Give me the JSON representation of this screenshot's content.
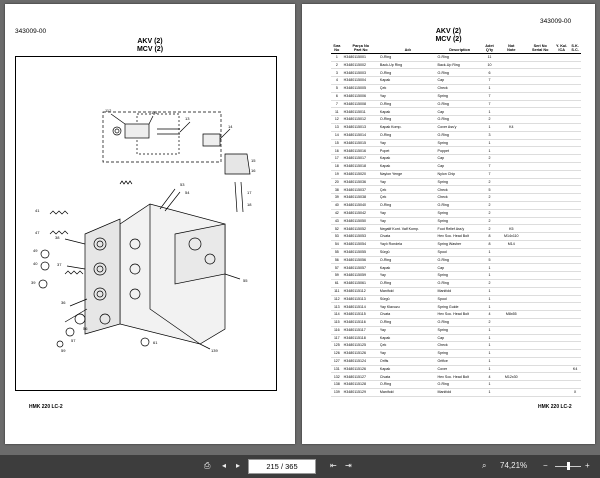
{
  "left_page": {
    "doc_number": "343009-00",
    "title_1": "AKV (2)",
    "title_2": "MCV (2)",
    "footer": "HMK 220 LC-2"
  },
  "right_page": {
    "doc_number": "343009-00",
    "title_1": "AKV (2)",
    "title_2": "MCV (2)",
    "footer": "HMK 220 LC-2",
    "headers": {
      "no": "Sıra\nNo",
      "part_no": "Parça No\nPart No",
      "name": "Adı",
      "description": "Description",
      "qty": "Adet\nQ'ty",
      "note": "Not\nNote",
      "serial_no": "Seri No\nSerial No",
      "cat": "Y. Kul.\nICA",
      "sc": "S.K.\nS.C."
    },
    "rows": [
      {
        "no": "1",
        "part_no": "H3480115001",
        "name": "O-Ring",
        "desc": "O-Ring",
        "qty": "11",
        "note": "",
        "cat": "",
        "sc": ""
      },
      {
        "no": "2",
        "part_no": "H3480115002",
        "name": "Back-Up Ring",
        "desc": "Back-Up Ring",
        "qty": "10",
        "note": "",
        "cat": "",
        "sc": ""
      },
      {
        "no": "3",
        "part_no": "H3480115003",
        "name": "O-Ring",
        "desc": "O-Ring",
        "qty": "6",
        "note": "",
        "cat": "",
        "sc": ""
      },
      {
        "no": "4",
        "part_no": "H3480115004",
        "name": "Kapak",
        "desc": "Cap",
        "qty": "7",
        "note": "",
        "cat": "",
        "sc": ""
      },
      {
        "no": "5",
        "part_no": "H3480115005",
        "name": "Çek",
        "desc": "Check",
        "qty": "1",
        "note": "",
        "cat": "",
        "sc": ""
      },
      {
        "no": "6",
        "part_no": "H3480115006",
        "name": "Yay",
        "desc": "Spring",
        "qty": "7",
        "note": "",
        "cat": "",
        "sc": ""
      },
      {
        "no": "7",
        "part_no": "H3480115008",
        "name": "O-Ring",
        "desc": "O-Ring",
        "qty": "7",
        "note": "",
        "cat": "",
        "sc": ""
      },
      {
        "no": "11",
        "part_no": "H3480115011",
        "name": "Kapak",
        "desc": "Cap",
        "qty": "1",
        "note": "",
        "cat": "",
        "sc": ""
      },
      {
        "no": "12",
        "part_no": "H3480115012",
        "name": "O-Ring",
        "desc": "O-Ring",
        "qty": "2",
        "note": "",
        "cat": "",
        "sc": ""
      },
      {
        "no": "13",
        "part_no": "H3480115013",
        "name": "Kapak Komp.",
        "desc": "Cover Ass'y",
        "qty": "1",
        "note": "K4",
        "cat": "",
        "sc": ""
      },
      {
        "no": "14",
        "part_no": "H3480115014",
        "name": "O-Ring",
        "desc": "O-Ring",
        "qty": "3",
        "note": "",
        "cat": "",
        "sc": ""
      },
      {
        "no": "15",
        "part_no": "H3480115015",
        "name": "Yay",
        "desc": "Spring",
        "qty": "1",
        "note": "",
        "cat": "",
        "sc": ""
      },
      {
        "no": "16",
        "part_no": "H3480115016",
        "name": "Popet",
        "desc": "Poppet",
        "qty": "1",
        "note": "",
        "cat": "",
        "sc": ""
      },
      {
        "no": "17",
        "part_no": "H3480115017",
        "name": "Kapak",
        "desc": "Cap",
        "qty": "2",
        "note": "",
        "cat": "",
        "sc": ""
      },
      {
        "no": "18",
        "part_no": "H3480115018",
        "name": "Kapak",
        "desc": "Cap",
        "qty": "7",
        "note": "",
        "cat": "",
        "sc": ""
      },
      {
        "no": "19",
        "part_no": "H3480115020",
        "name": "Naylon Yenge",
        "desc": "Nylon Chip",
        "qty": "7",
        "note": "",
        "cat": "",
        "sc": ""
      },
      {
        "no": "20",
        "part_no": "H3480115036",
        "name": "Yay",
        "desc": "Spring",
        "qty": "2",
        "note": "",
        "cat": "",
        "sc": ""
      },
      {
        "no": "38",
        "part_no": "H3480115037",
        "name": "Çek",
        "desc": "Check",
        "qty": "5",
        "note": "",
        "cat": "",
        "sc": ""
      },
      {
        "no": "39",
        "part_no": "H3480115038",
        "name": "Çek",
        "desc": "Check",
        "qty": "2",
        "note": "",
        "cat": "",
        "sc": ""
      },
      {
        "no": "40",
        "part_no": "H3480115040",
        "name": "O-Ring",
        "desc": "O-Ring",
        "qty": "2",
        "note": "",
        "cat": "",
        "sc": ""
      },
      {
        "no": "42",
        "part_no": "H3480115042",
        "name": "Yay",
        "desc": "Spring",
        "qty": "2",
        "note": "",
        "cat": "",
        "sc": ""
      },
      {
        "no": "43",
        "part_no": "H3480115050",
        "name": "Yay",
        "desc": "Spring",
        "qty": "2",
        "note": "",
        "cat": "",
        "sc": ""
      },
      {
        "no": "52",
        "part_no": "H3480115052",
        "name": "Negatif Kont. Valf Komp.",
        "desc": "Foot Relief Ass'y",
        "qty": "2",
        "note": "K5",
        "cat": "",
        "sc": ""
      },
      {
        "no": "53",
        "part_no": "H3480115053",
        "name": "Civata",
        "desc": "Hex Soc. Head Bolt",
        "qty": "8",
        "note": "M14x110",
        "cat": "",
        "sc": ""
      },
      {
        "no": "54",
        "part_no": "H3480115054",
        "name": "Yaylı Rondela",
        "desc": "Spring Washer",
        "qty": "8",
        "note": "M14",
        "cat": "",
        "sc": ""
      },
      {
        "no": "55",
        "part_no": "H3480115055",
        "name": "Sürgü",
        "desc": "Spool",
        "qty": "1",
        "note": "",
        "cat": "",
        "sc": ""
      },
      {
        "no": "56",
        "part_no": "H3480115056",
        "name": "O-Ring",
        "desc": "O-Ring",
        "qty": "5",
        "note": "",
        "cat": "",
        "sc": ""
      },
      {
        "no": "57",
        "part_no": "H3480115057",
        "name": "Kapak",
        "desc": "Cap",
        "qty": "1",
        "note": "",
        "cat": "",
        "sc": ""
      },
      {
        "no": "59",
        "part_no": "H3480115059",
        "name": "Yay",
        "desc": "Spring",
        "qty": "1",
        "note": "",
        "cat": "",
        "sc": ""
      },
      {
        "no": "61",
        "part_no": "H3480115061",
        "name": "O-Ring",
        "desc": "O-Ring",
        "qty": "2",
        "note": "",
        "cat": "",
        "sc": ""
      },
      {
        "no": "111",
        "part_no": "H3480115112",
        "name": "Manifold",
        "desc": "Manifold",
        "qty": "1",
        "note": "",
        "cat": "",
        "sc": ""
      },
      {
        "no": "112",
        "part_no": "H3480115113",
        "name": "Sürgü",
        "desc": "Spool",
        "qty": "1",
        "note": "",
        "cat": "",
        "sc": ""
      },
      {
        "no": "113",
        "part_no": "H3480115114",
        "name": "Yay Klavuzu",
        "desc": "Spring Guide",
        "qty": "1",
        "note": "",
        "cat": "",
        "sc": ""
      },
      {
        "no": "114",
        "part_no": "H3480115115",
        "name": "Civata",
        "desc": "Hex Soc. Head Bolt",
        "qty": "4",
        "note": "M8x55",
        "cat": "",
        "sc": ""
      },
      {
        "no": "115",
        "part_no": "H3480115116",
        "name": "O-Ring",
        "desc": "O-Ring",
        "qty": "2",
        "note": "",
        "cat": "",
        "sc": ""
      },
      {
        "no": "116",
        "part_no": "H3480115117",
        "name": "Yay",
        "desc": "Spring",
        "qty": "1",
        "note": "",
        "cat": "",
        "sc": ""
      },
      {
        "no": "117",
        "part_no": "H3480115118",
        "name": "Kapak",
        "desc": "Cap",
        "qty": "1",
        "note": "",
        "cat": "",
        "sc": ""
      },
      {
        "no": "125",
        "part_no": "H3480115125",
        "name": "Çek",
        "desc": "Check",
        "qty": "1",
        "note": "",
        "cat": "",
        "sc": ""
      },
      {
        "no": "126",
        "part_no": "H3480115126",
        "name": "Yay",
        "desc": "Spring",
        "qty": "1",
        "note": "",
        "cat": "",
        "sc": ""
      },
      {
        "no": "127",
        "part_no": "H3480115124",
        "name": "Orifis",
        "desc": "Orifice",
        "qty": "1",
        "note": "",
        "cat": "",
        "sc": ""
      },
      {
        "no": "131",
        "part_no": "H3480115126",
        "name": "Kapak",
        "desc": "Cover",
        "qty": "1",
        "note": "",
        "cat": "",
        "sc": "K4"
      },
      {
        "no": "132",
        "part_no": "H3480115127",
        "name": "Civata",
        "desc": "Hex Soc. Head Bolt",
        "qty": "4",
        "note": "M12x30",
        "cat": "",
        "sc": ""
      },
      {
        "no": "138",
        "part_no": "H3480115128",
        "name": "O-Ring",
        "desc": "O-Ring",
        "qty": "1",
        "note": "",
        "cat": "",
        "sc": ""
      },
      {
        "no": "139",
        "part_no": "H3480115129",
        "name": "Manifold",
        "desc": "Manifold",
        "qty": "1",
        "note": "",
        "cat": "",
        "sc": "X"
      }
    ]
  },
  "diagram_callouts": [
    "112",
    "131",
    "13",
    "14",
    "15",
    "16",
    "17",
    "18",
    "41",
    "47",
    "49",
    "40",
    "39",
    "38",
    "37",
    "36",
    "56",
    "57",
    "59",
    "61",
    "53",
    "54",
    "55",
    "139",
    "4",
    "5",
    "6",
    "7",
    "11",
    "12",
    "1",
    "2",
    "3"
  ],
  "toolbar": {
    "page_current": "215",
    "page_separator": "/",
    "page_total": "365",
    "zoom": "74,21%",
    "icons": [
      "print-icon",
      "search-icon",
      "zoom-out-icon",
      "zoom-in-icon"
    ]
  }
}
